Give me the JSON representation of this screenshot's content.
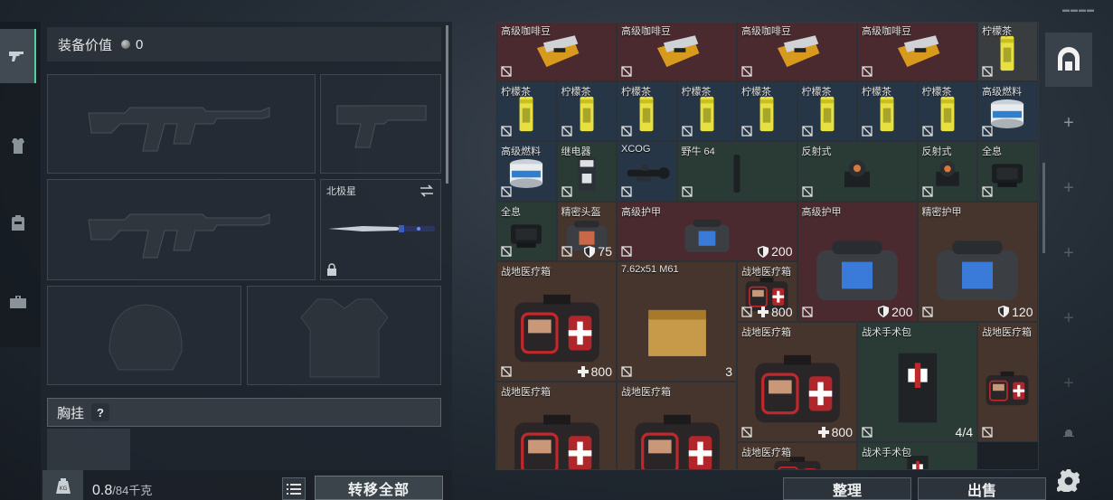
{
  "equipment": {
    "value_label": "装备价值",
    "value": "0",
    "melee_name": "北极星",
    "chest_rig_label": "胸挂",
    "chest_rig_help": "?"
  },
  "footer": {
    "weight_current": "0.8",
    "weight_max": "/84千克",
    "transfer_all": "转移全部",
    "sort": "整理",
    "sell": "出售"
  },
  "items": [
    {
      "name": "高级咖啡豆",
      "color": "red"
    },
    {
      "name": "高级咖啡豆",
      "color": "red"
    },
    {
      "name": "高级咖啡豆",
      "color": "red"
    },
    {
      "name": "高级咖啡豆",
      "color": "red"
    },
    {
      "name": "柠檬茶",
      "color": "grey"
    },
    {
      "name": "柠檬茶",
      "color": "blue"
    },
    {
      "name": "柠檬茶",
      "color": "blue"
    },
    {
      "name": "柠檬茶",
      "color": "blue"
    },
    {
      "name": "柠檬茶",
      "color": "blue"
    },
    {
      "name": "柠檬茶",
      "color": "blue"
    },
    {
      "name": "柠檬茶",
      "color": "blue"
    },
    {
      "name": "柠檬茶",
      "color": "blue"
    },
    {
      "name": "柠檬茶",
      "color": "blue"
    },
    {
      "name": "高级燃料",
      "color": "blue"
    },
    {
      "name": "高级燃料",
      "color": "blue"
    },
    {
      "name": "继电器",
      "color": "green"
    },
    {
      "name": "XCOG",
      "color": "blue"
    },
    {
      "name": "野牛 64",
      "color": "green"
    },
    {
      "name": "反射式",
      "color": "green"
    },
    {
      "name": "反射式",
      "color": "green"
    },
    {
      "name": "全息",
      "color": "green"
    },
    {
      "name": "全息",
      "color": "green"
    },
    {
      "name": "精密头盔",
      "value": "75",
      "color": "brown"
    },
    {
      "name": "高级护甲",
      "value": "200",
      "color": "red"
    },
    {
      "name": "高级护甲",
      "value": "200",
      "color": "red"
    },
    {
      "name": "精密护甲",
      "value": "120",
      "color": "brown"
    },
    {
      "name": "战地医疗箱",
      "value": "800",
      "color": "brown"
    },
    {
      "name": "7.62x51 M61",
      "value": "3",
      "color": "brown"
    },
    {
      "name": "战地医疗箱",
      "value": "800",
      "color": "brown"
    },
    {
      "name": "战地医疗箱",
      "value": "800",
      "color": "brown"
    },
    {
      "name": "战术手术包",
      "value": "4/4",
      "color": "green"
    },
    {
      "name": "战地医疗箱",
      "color": "brown"
    },
    {
      "name": "战地医疗箱",
      "color": "brown"
    },
    {
      "name": "战地医疗箱",
      "color": "brown"
    },
    {
      "name": "战地医疗箱",
      "color": "brown"
    },
    {
      "name": "战术手术包",
      "color": "green"
    }
  ],
  "icons": {
    "tabs": [
      "pistol-icon",
      "armor-icon",
      "backpack-icon",
      "toolbox-icon"
    ],
    "rail": [
      "container-icon",
      "plus-icon",
      "plus-icon",
      "plus-icon",
      "plus-icon",
      "plus-icon",
      "gear-icon"
    ]
  }
}
